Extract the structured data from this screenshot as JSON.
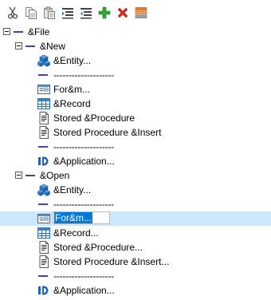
{
  "toolbar": {
    "buttons": [
      {
        "icon": "cut-icon"
      },
      {
        "icon": "copy-icon"
      },
      {
        "icon": "paste-icon"
      },
      {
        "icon": "indent-icon"
      },
      {
        "icon": "outdent-icon"
      },
      {
        "icon": "add-icon"
      },
      {
        "icon": "delete-icon"
      },
      {
        "icon": "menu-properties-icon"
      }
    ]
  },
  "tree": {
    "file": {
      "label": "&File"
    },
    "new": {
      "label": "&New",
      "items": {
        "entity": "&Entity...",
        "sep1": "--------------------",
        "form": "For&m...",
        "record": "&Record",
        "stored_procedure": "Stored &Procedure",
        "stored_procedure_insert": "Stored Procedure &Insert",
        "sep2": "--------------------",
        "application": "&Application..."
      }
    },
    "open": {
      "label": "&Open",
      "items": {
        "entity": "&Entity...",
        "sep1": "--------------------",
        "form_editing": "For&m...",
        "record": "&Record...",
        "stored_procedure": "Stored &Procedure...",
        "stored_procedure_insert": "Stored Procedure &Insert...",
        "sep2": "--------------------",
        "application": "&Application..."
      }
    }
  },
  "colors": {
    "selection": "#cce8ff",
    "edit_highlight": "#0078d7",
    "tree_line": "#4a3fb0"
  }
}
